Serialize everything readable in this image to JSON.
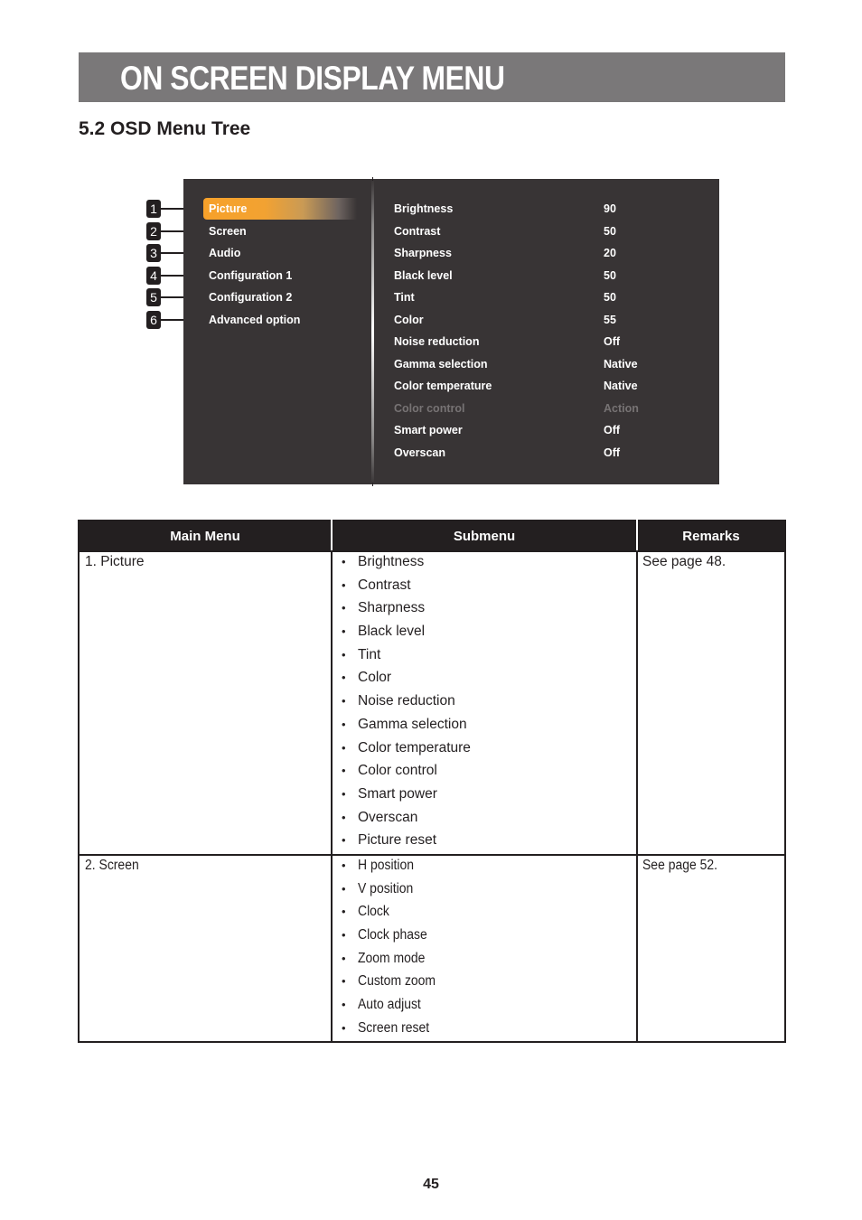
{
  "chapter": {
    "title": "ON SCREEN DISPLAY MENU"
  },
  "section": {
    "title": "5.2 OSD Menu Tree"
  },
  "osd": {
    "main_menu": [
      {
        "number": "1",
        "label": "Picture",
        "selected": true
      },
      {
        "number": "2",
        "label": "Screen",
        "selected": false
      },
      {
        "number": "3",
        "label": "Audio",
        "selected": false
      },
      {
        "number": "4",
        "label": "Configuration 1",
        "selected": false
      },
      {
        "number": "5",
        "label": "Configuration 2",
        "selected": false
      },
      {
        "number": "6",
        "label": "Advanced option",
        "selected": false
      }
    ],
    "submenu": [
      {
        "label": "Brightness",
        "value": "90",
        "disabled": false
      },
      {
        "label": "Contrast",
        "value": "50",
        "disabled": false
      },
      {
        "label": "Sharpness",
        "value": "20",
        "disabled": false
      },
      {
        "label": "Black level",
        "value": "50",
        "disabled": false
      },
      {
        "label": "Tint",
        "value": "50",
        "disabled": false
      },
      {
        "label": "Color",
        "value": "55",
        "disabled": false
      },
      {
        "label": "Noise reduction",
        "value": "Off",
        "disabled": false
      },
      {
        "label": "Gamma selection",
        "value": "Native",
        "disabled": false
      },
      {
        "label": "Color temperature",
        "value": "Native",
        "disabled": false
      },
      {
        "label": "Color control",
        "value": "Action",
        "disabled": true
      },
      {
        "label": "Smart power",
        "value": "Off",
        "disabled": false
      },
      {
        "label": "Overscan",
        "value": "Off",
        "disabled": false
      }
    ],
    "colors": {
      "background": "#383435",
      "highlight": "#f7a12a",
      "disabled_text": "#777374"
    }
  },
  "table": {
    "headers": [
      "Main Menu",
      "Submenu",
      "Remarks"
    ],
    "rows": [
      {
        "main": "1. Picture",
        "submenu": [
          "Brightness",
          "Contrast",
          "Sharpness",
          "Black level",
          "Tint",
          "Color",
          "Noise reduction",
          "Gamma selection",
          "Color temperature",
          "Color control",
          "Smart power",
          "Overscan",
          "Picture reset"
        ],
        "remarks": "See page 48."
      },
      {
        "main": "2. Screen",
        "submenu": [
          "H position",
          "V position",
          "Clock",
          "Clock phase",
          "Zoom mode",
          "Custom zoom",
          "Auto adjust",
          "Screen reset"
        ],
        "remarks": "See page 52."
      }
    ],
    "bullet": "•"
  },
  "footer": {
    "page_number": "45"
  }
}
